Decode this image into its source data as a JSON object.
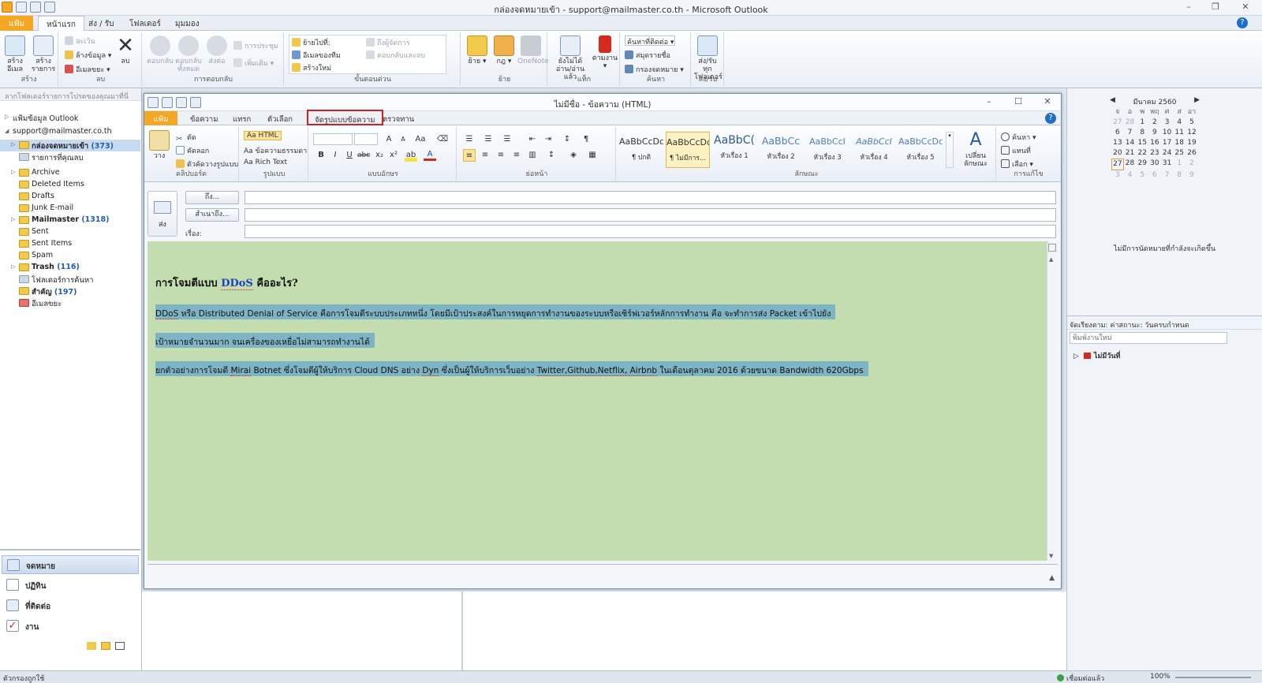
{
  "window": {
    "title": "กล่องจดหมายเข้า - support@mailmaster.co.th - Microsoft Outlook"
  },
  "main_tabs": [
    "แฟ้ม",
    "หน้าแรก",
    "ส่ง / รับ",
    "โฟลเดอร์",
    "มุมมอง"
  ],
  "main_ribbon": {
    "new_email": "สร้างอีเมล",
    "new_items": "สร้างรายการ",
    "group_new": "สร้าง",
    "ignore": "ละเว้น",
    "cleanup": "ล้างข้อมูล",
    "junk": "อีเมลขยะ",
    "delete": "ลบ",
    "group_delete": "ลบ",
    "reply": "ตอบกลับ",
    "reply_all": "ตอบกลับทั้งหมด",
    "forward": "ส่งต่อ",
    "meeting": "การประชุม",
    "more": "เพิ่มเติม",
    "group_respond": "การตอบกลับ",
    "qs_move": "ย้ายไปที่:",
    "qs_team": "อีเมลของทีม",
    "qs_new": "สร้างใหม่",
    "qs_manager": "ถึงผู้จัดการ",
    "qs_done": "ตอบกลับและลบ",
    "group_quicksteps": "ขั้นตอนด่วน",
    "move": "ย้าย",
    "rules": "กฎ",
    "onenote": "OneNote",
    "group_move": "ย้าย",
    "unread": "ยังไม่ได้อ่าน/อ่านแล้ว",
    "followup": "ตามงาน",
    "group_tags": "แท็ก",
    "find_contact": "ค้นหาที่ติดต่อ",
    "address_book": "สมุดรายชื่อ",
    "filter_email": "กรองจดหมาย",
    "group_find": "ค้นหา",
    "send_receive_all": "ส่ง/รับทุกโฟลเดอร์",
    "group_sendreceive": "ส่ง/รับ"
  },
  "nav": {
    "hint": "ลากโฟลเดอร์รายการโปรดของคุณมาที่นี่",
    "outlook_data": "แฟ้มข้อมูล Outlook",
    "account": "support@mailmaster.co.th",
    "folders": [
      {
        "label": "กล่องจดหมายเข้า",
        "count": "(373)"
      },
      {
        "label": "รายการที่คุณลบ",
        "count": ""
      },
      {
        "label": "Archive",
        "count": ""
      },
      {
        "label": "Deleted Items",
        "count": ""
      },
      {
        "label": "Drafts",
        "count": ""
      },
      {
        "label": "Junk E-mail",
        "count": ""
      },
      {
        "label": "Mailmaster",
        "count": "(1318)"
      },
      {
        "label": "Sent",
        "count": ""
      },
      {
        "label": "Sent Items",
        "count": ""
      },
      {
        "label": "Spam",
        "count": ""
      },
      {
        "label": "Trash",
        "count": "(116)"
      },
      {
        "label": "โฟลเดอร์การค้นหา",
        "count": ""
      },
      {
        "label": "สำคัญ",
        "count": "(197)"
      },
      {
        "label": "อีเมลขยะ",
        "count": ""
      }
    ],
    "buttons": [
      "จดหมาย",
      "ปฏิทิน",
      "ที่ติดต่อ",
      "งาน"
    ]
  },
  "calendar": {
    "month": "มีนาคม 2560",
    "days": [
      "จ",
      "อ",
      "พ",
      "พฤ",
      "ศ",
      "ส",
      "อา"
    ],
    "weeks": [
      [
        "27",
        "28",
        "1",
        "2",
        "3",
        "4",
        "5"
      ],
      [
        "6",
        "7",
        "8",
        "9",
        "10",
        "11",
        "12"
      ],
      [
        "13",
        "14",
        "15",
        "16",
        "17",
        "18",
        "19"
      ],
      [
        "20",
        "21",
        "22",
        "23",
        "24",
        "25",
        "26"
      ],
      [
        "27",
        "28",
        "29",
        "30",
        "31",
        "1",
        "2"
      ],
      [
        "3",
        "4",
        "5",
        "6",
        "7",
        "8",
        "9"
      ]
    ],
    "no_appointments": "ไม่มีการนัดหมายที่กำลังจะเกิดขึ้น"
  },
  "tasks": {
    "arrange": "จัดเรียงตาม: ค่าสถานะ: วันครบกำหนด",
    "input_placeholder": "พิมพ์งานใหม่",
    "group": "ไม่มีวันที่"
  },
  "status": {
    "left": "ตัวกรองถูกใช้",
    "connected": "เชื่อมต่อแล้ว",
    "zoom": "100%"
  },
  "compose": {
    "title": "ไม่มีชื่อ - ข้อความ (HTML)",
    "tabs": [
      "แฟ้ม",
      "ข้อความ",
      "แทรก",
      "ตัวเลือก",
      "จัดรูปแบบข้อความ",
      "ตรวจทาน"
    ],
    "ribbon": {
      "paste": "วาง",
      "cut": "ตัด",
      "copy": "คัดลอก",
      "format_painter": "ตัวคัดวางรูปแบบ",
      "group_clipboard": "คลิปบอร์ด",
      "fmt_html": "HTML",
      "fmt_plain": "ข้อความธรรมดา",
      "fmt_rich": "Rich Text",
      "group_format": "รูปแบบ",
      "group_font": "แบบอักษร",
      "group_paragraph": "ย่อหน้า",
      "styles": [
        {
          "preview": "AaBbCcDc",
          "name": "¶ ปกติ"
        },
        {
          "preview": "AaBbCcDc",
          "name": "¶ ไม่มีการ..."
        },
        {
          "preview": "AaBbC(",
          "name": "หัวเรื่อง 1"
        },
        {
          "preview": "AaBbCc",
          "name": "หัวเรื่อง 2"
        },
        {
          "preview": "AaBbCcI",
          "name": "หัวเรื่อง 3"
        },
        {
          "preview": "AaBbCcI",
          "name": "หัวเรื่อง 4"
        },
        {
          "preview": "AaBbCcDc",
          "name": "หัวเรื่อง 5"
        }
      ],
      "change_styles": "เปลี่ยนลักษณะ",
      "group_styles": "ลักษณะ",
      "find": "ค้นหา",
      "replace": "แทนที่",
      "select": "เลือก",
      "group_editing": "การแก้ไข"
    },
    "send": "ส่ง",
    "to_button": "ถึง...",
    "cc_button": "สำเนาถึง...",
    "subject_label": "เรื่อง:",
    "body": {
      "heading_prefix": "การโจมตีแบบ ",
      "heading_ddos": "DDoS",
      "heading_suffix": " คืออะไร?",
      "line1_ddos": "DDoS",
      "line1_rest": " หรือ Distributed Denial of Service คือการโจมตีระบบประเภทหนึ่ง โดยมีเป้าประสงค์ในการหยุดการทำงานของระบบหรือเซิร์ฟเวอร์หลักการทำงาน คือ จะทำการส่ง Packet เข้าไปยัง",
      "line2": "เป้าหมายจำนวนมาก จนเครื่องของเหยื่อไม่สามารถทำงานได้",
      "line3_a": "ยกตัวอย่างการโจมตี ",
      "line3_mirai": "Mirai",
      "line3_b": " Botnet ซึ่งโจมตีผู้ให้บริการ Cloud DNS อย่าง ",
      "line3_dyn": "Dyn",
      "line3_c": " ซึ่งเป็นผู้ให้บริการเว็บอย่าง ",
      "line3_sites": "Twitter,Github,Netflix, Airbnb",
      "line3_d": " ในเดือนตุลาคม 2016 ด้วยขนาด Bandwidth 620Gbps"
    }
  }
}
